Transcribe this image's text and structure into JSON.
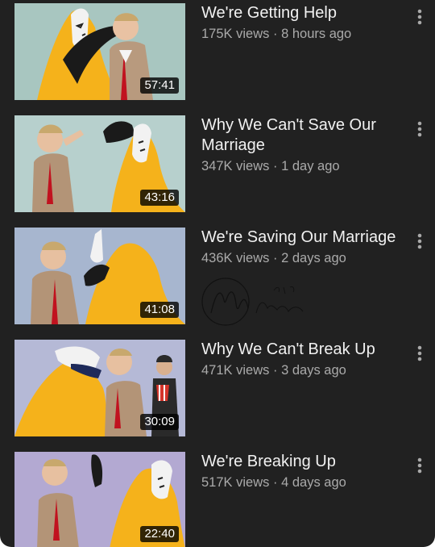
{
  "videos": [
    {
      "title": "We're Getting Help",
      "views": "175K views",
      "sep": "·",
      "age": "8 hours ago",
      "duration": "57:41",
      "more_icon": "more-vert-icon"
    },
    {
      "title": "Why We Can't Save Our Marriage",
      "views": "347K views",
      "sep": "·",
      "age": "1 day ago",
      "duration": "43:16",
      "more_icon": "more-vert-icon"
    },
    {
      "title": "We're Saving Our Marriage",
      "views": "436K views",
      "sep": "·",
      "age": "2 days ago",
      "duration": "41:08",
      "more_icon": "more-vert-icon"
    },
    {
      "title": "Why We Can't Break Up",
      "views": "471K views",
      "sep": "·",
      "age": "3 days ago",
      "duration": "30:09",
      "more_icon": "more-vert-icon"
    },
    {
      "title": "We're Breaking Up",
      "views": "517K views",
      "sep": "·",
      "age": "4 days ago",
      "duration": "22:40",
      "more_icon": "more-vert-icon"
    }
  ],
  "signature": {
    "name": "McClacken",
    "date": "23 May 23"
  },
  "colors": {
    "background": "#212121",
    "title": "#f1f1f1",
    "meta": "#aaaaaa",
    "cloak": "#f5b21b"
  }
}
